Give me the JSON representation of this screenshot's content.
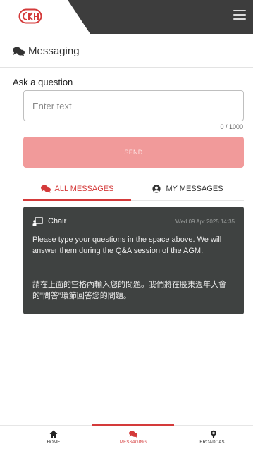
{
  "header": {
    "logo_icon": "ckh-logo-icon",
    "menu_icon": "hamburger-menu-icon",
    "colors": {
      "bar": "#3d3d3d",
      "logo": "#d43a3a"
    }
  },
  "page": {
    "title": "Messaging",
    "title_icon": "chat-bubbles-icon"
  },
  "question": {
    "label": "Ask a question",
    "placeholder": "Enter text",
    "value": "",
    "char_count": "0 / 1000",
    "send_label": "SEND"
  },
  "tabs": [
    {
      "label": "ALL MESSAGES",
      "icon": "chat-bubbles-icon",
      "active": true
    },
    {
      "label": "MY MESSAGES",
      "icon": "user-circle-icon",
      "active": false
    }
  ],
  "messages": [
    {
      "sender": "Chair",
      "icon": "presenter-icon",
      "timestamp": "Wed 09 Apr 2025 14:35",
      "text_en": "Please type your questions in the space above.  We will answer them during the Q&A session of the AGM.",
      "text_zh": "請在上面的空格內輸入您的問題。我們將在股東週年大會的\"問答\"環節回答您的問題。"
    }
  ],
  "bottom_nav": [
    {
      "label": "HOME",
      "icon": "home-icon",
      "active": false
    },
    {
      "label": "MESSAGING",
      "icon": "chat-bubbles-icon",
      "active": true
    },
    {
      "label": "BROADCAST",
      "icon": "broadcast-icon",
      "active": false
    }
  ],
  "colors": {
    "accent": "#d43a3a",
    "send_button": "#f19a9a",
    "message_card": "#3f4241"
  }
}
